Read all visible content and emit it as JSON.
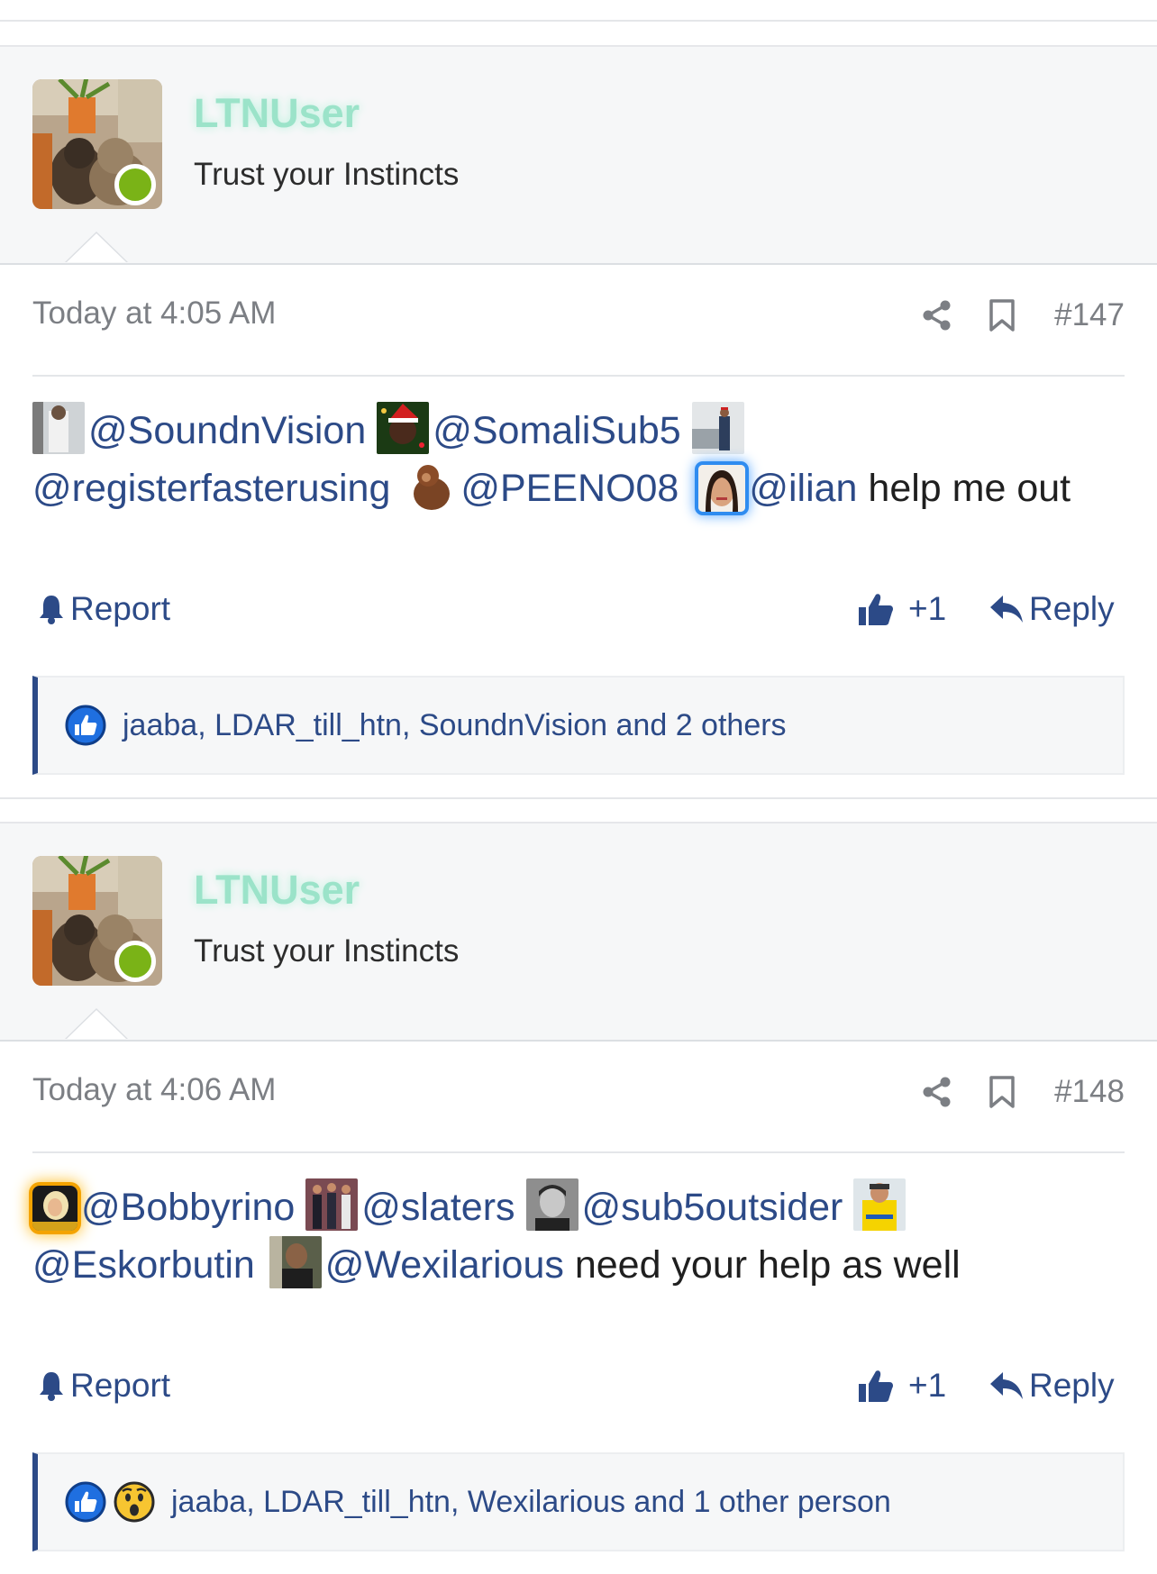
{
  "posts": [
    {
      "username": "LTNUser",
      "tagline": "Trust your Instincts",
      "timestamp": "Today at 4:05 AM",
      "post_number": "#147",
      "mentions": [
        "@SoundnVision",
        "@SomaliSub5",
        "@registerfasterusing",
        "@PEENO08",
        "@ilian"
      ],
      "message": "help me out",
      "actions": {
        "report": "Report",
        "like": "+1",
        "reply": "Reply"
      },
      "likes_text": "jaaba, LDAR_till_htn, SoundnVision and 2 others"
    },
    {
      "username": "LTNUser",
      "tagline": "Trust your Instincts",
      "timestamp": "Today at 4:06 AM",
      "post_number": "#148",
      "mentions": [
        "@Bobbyrino",
        "@slaters",
        "@sub5outsider",
        "@Eskorbutin",
        "@Wexilarious"
      ],
      "message": "need your help as well",
      "actions": {
        "report": "Report",
        "like": "+1",
        "reply": "Reply"
      },
      "likes_text": "jaaba, LDAR_till_htn, Wexilarious and 1 other person"
    }
  ],
  "colors": {
    "link": "#2c4a87",
    "muted": "#7c7f84",
    "online": "#7ab317",
    "username": "#9be3c9"
  }
}
